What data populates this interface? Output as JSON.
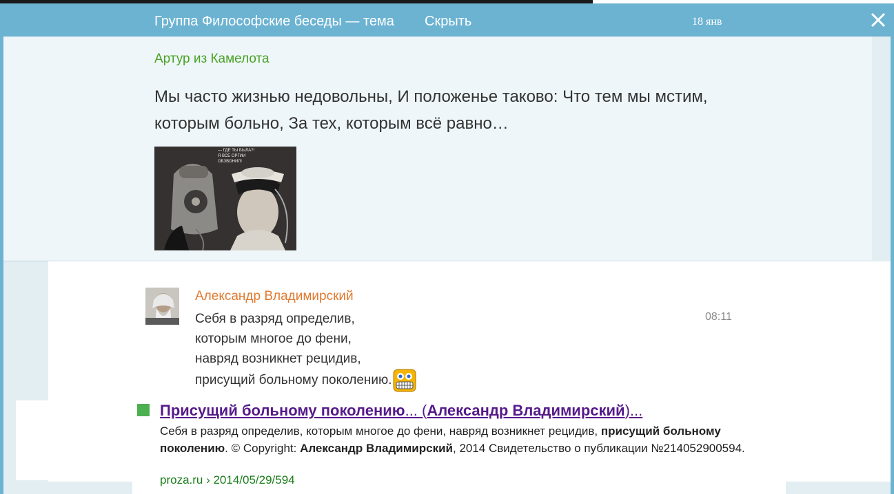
{
  "header": {
    "title": "Группа Философские беседы — тема",
    "hide_label": "Скрыть",
    "date": "18 янв",
    "close_icon": "close-icon"
  },
  "post": {
    "author": "Артур из Камелота",
    "text": "Мы часто жизнью недовольны, И положенье таково: Что тем мы мстим, которым больно, За тех, которым всё равно…",
    "image_caption": "— ГДЕ ТЫ БЫЛА?! Я ВСЕ ОРГИИ ОБЗВОНИЛ!"
  },
  "comment": {
    "author": "Александр Владимирский",
    "time": "08:11",
    "lines": [
      "Себя в разряд определив,",
      "которым многое до фени,",
      "навряд возникнет рецидив,",
      "присущий больному поколению."
    ],
    "emoji": "grin-emoji-icon"
  },
  "search_result": {
    "title_part1": "Присущий больному поколению",
    "title_part2": "... (",
    "title_part3": "Александр Владимирский",
    "title_part4": ")...",
    "desc_plain1": "Себя в разряд определив, которым многое до фени, навряд возникнет рецидив, ",
    "desc_bold1": "присущий больному поколению",
    "desc_plain2": ". © Copyright: ",
    "desc_bold2": "Александр Владимирский",
    "desc_plain3": ", 2014 Свидетельство о публикации №214052900594.",
    "url": "proza.ru › 2014/05/29/594"
  },
  "colors": {
    "header_bg": "#6cb3d2",
    "post_author": "#4aa225",
    "comment_author": "#e07a2f",
    "link": "#551a8b",
    "url": "#1a7d1a"
  }
}
